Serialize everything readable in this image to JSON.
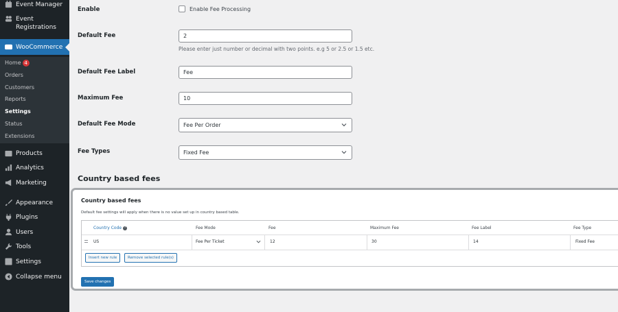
{
  "sidebar": {
    "items_top": [
      {
        "label": "Event Manager",
        "icon": "calendar-icon"
      },
      {
        "label": "Event Registrations",
        "icon": "people-icon"
      }
    ],
    "woocommerce": {
      "label": "WooCommerce",
      "icon": "woo-icon"
    },
    "submenu": [
      {
        "label": "Home",
        "badge": "4"
      },
      {
        "label": "Orders"
      },
      {
        "label": "Customers"
      },
      {
        "label": "Reports"
      },
      {
        "label": "Settings",
        "current": true
      },
      {
        "label": "Status"
      },
      {
        "label": "Extensions"
      }
    ],
    "items_bottom": [
      {
        "label": "Products",
        "icon": "products-icon"
      },
      {
        "label": "Analytics",
        "icon": "analytics-icon"
      },
      {
        "label": "Marketing",
        "icon": "megaphone-icon"
      },
      {
        "label": "Appearance",
        "icon": "brush-icon"
      },
      {
        "label": "Plugins",
        "icon": "plugin-icon"
      },
      {
        "label": "Users",
        "icon": "user-icon"
      },
      {
        "label": "Tools",
        "icon": "wrench-icon"
      },
      {
        "label": "Settings",
        "icon": "settings-icon"
      },
      {
        "label": "Collapse menu",
        "icon": "collapse-icon"
      }
    ]
  },
  "form": {
    "enable": {
      "label": "Enable",
      "checkbox_label": "Enable Fee Processing",
      "checked": false
    },
    "default_fee": {
      "label": "Default Fee",
      "value": "2",
      "help": "Please enter just number or decimal with two points. e.g 5 or 2.5 or 1.5 etc."
    },
    "default_fee_label": {
      "label": "Default Fee Label",
      "value": "Fee"
    },
    "maximum_fee": {
      "label": "Maximum Fee",
      "value": "10"
    },
    "default_fee_mode": {
      "label": "Default Fee Mode",
      "value": "Fee Per Order"
    },
    "fee_types": {
      "label": "Fee Types",
      "value": "Fixed Fee"
    }
  },
  "country_section": {
    "title": "Country based fees",
    "panel_title": "Country based fees",
    "description": "Default fee settings will apply when there is no value set up in country based table.",
    "columns": [
      "Country Code",
      "Fee Mode",
      "Fee",
      "Maximum Fee",
      "Fee Label",
      "Fee Type"
    ],
    "help_icon": "help-icon",
    "rows": [
      {
        "country_code": "US",
        "fee_mode": "Fee Per Ticket",
        "fee": "12",
        "maximum_fee": "30",
        "fee_label": "14",
        "fee_type": "Fixed Fee"
      }
    ],
    "insert_button": "Insert new rule",
    "remove_button": "Remove selected rule(s)",
    "save_button": "Save changes"
  },
  "colors": {
    "sidebar_bg": "#1d2327",
    "accent": "#2271b1",
    "badge": "#d63638"
  }
}
